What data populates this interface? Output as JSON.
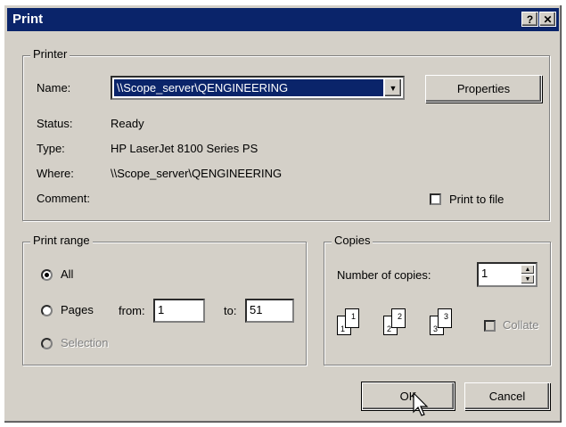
{
  "window": {
    "title": "Print",
    "help_label": "?",
    "close_label": "✕"
  },
  "printer": {
    "group_label": "Printer",
    "name_label": "Name:",
    "name_value": "\\\\Scope_server\\QENGINEERING",
    "properties_label": "Properties",
    "status_label": "Status:",
    "status_value": "Ready",
    "type_label": "Type:",
    "type_value": "HP LaserJet 8100 Series PS",
    "where_label": "Where:",
    "where_value": "\\\\Scope_server\\QENGINEERING",
    "comment_label": "Comment:",
    "comment_value": "",
    "print_to_file_label": "Print to file",
    "print_to_file_checked": false
  },
  "print_range": {
    "group_label": "Print range",
    "all_label": "All",
    "pages_label": "Pages",
    "from_label": "from:",
    "from_value": "1",
    "to_label": "to:",
    "to_value": "51",
    "selection_label": "Selection",
    "selected": "all"
  },
  "copies": {
    "group_label": "Copies",
    "number_label": "Number of copies:",
    "number_value": "1",
    "collate_label": "Collate",
    "collate_checked": false
  },
  "buttons": {
    "ok_label": "OK",
    "cancel_label": "Cancel"
  },
  "icons": {
    "dropdown": "chevron-down-icon",
    "spin_up": "arrow-up-icon",
    "spin_down": "arrow-down-icon",
    "cursor": "mouse-pointer-icon"
  }
}
